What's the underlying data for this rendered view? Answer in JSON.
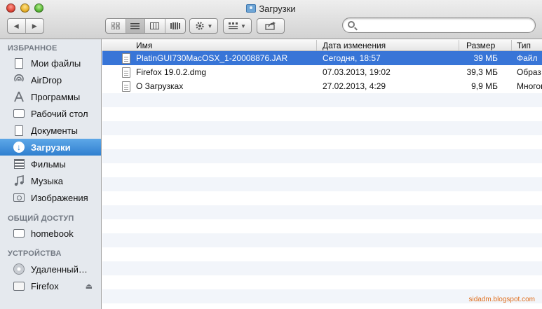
{
  "window": {
    "title": "Загрузки",
    "title_icon": "downloads-folder-icon"
  },
  "toolbar": {
    "back_icon": "◀",
    "forward_icon": "▶",
    "view_icons": [
      "icon-view-icon",
      "list-view-icon",
      "column-view-icon",
      "coverflow-view-icon"
    ],
    "action_icon": "gear-icon",
    "arrange_icon": "arrange-grid-icon",
    "share_icon": "share-icon",
    "search_value": ""
  },
  "sidebar": {
    "favorites_header": "ИЗБРАННОЕ",
    "favorites": [
      {
        "label": "Мои файлы",
        "icon": "files-icon"
      },
      {
        "label": "AirDrop",
        "icon": "airdrop-icon"
      },
      {
        "label": "Программы",
        "icon": "applications-icon"
      },
      {
        "label": "Рабочий стол",
        "icon": "desktop-icon"
      },
      {
        "label": "Документы",
        "icon": "documents-icon"
      },
      {
        "label": "Загрузки",
        "icon": "downloads-icon",
        "active": true
      },
      {
        "label": "Фильмы",
        "icon": "movies-icon"
      },
      {
        "label": "Музыка",
        "icon": "music-icon"
      },
      {
        "label": "Изображения",
        "icon": "pictures-icon"
      }
    ],
    "shared_header": "ОБЩИЙ ДОСТУП",
    "shared": [
      {
        "label": "homebook",
        "icon": "computer-icon"
      }
    ],
    "devices_header": "УСТРОЙСТВА",
    "devices": [
      {
        "label": "Удаленный…",
        "icon": "remote-disc-icon"
      },
      {
        "label": "Firefox",
        "icon": "drive-icon"
      }
    ]
  },
  "columns": {
    "name": "Имя",
    "date": "Дата изменения",
    "size": "Размер",
    "kind": "Тип"
  },
  "files": [
    {
      "name": "PlatinGUI730MacOSX_1-20008876.JAR",
      "date": "Сегодня, 18:57",
      "size": "39 МБ",
      "kind": "Файл"
    },
    {
      "name": "Firefox 19.0.2.dmg",
      "date": "07.03.2013, 19:02",
      "size": "39,3 МБ",
      "kind": "Образ"
    },
    {
      "name": "О Загрузках",
      "date": "27.02.2013, 4:29",
      "size": "9,9 МБ",
      "kind": "Многов"
    }
  ],
  "watermark": "sidadm.blogspot.com",
  "colors": {
    "selection": "#3875d7",
    "sidebar_active": "#2f7fcf",
    "sidebar_bg": "#e5e9ee",
    "row_alt": "#f2f5fa"
  }
}
